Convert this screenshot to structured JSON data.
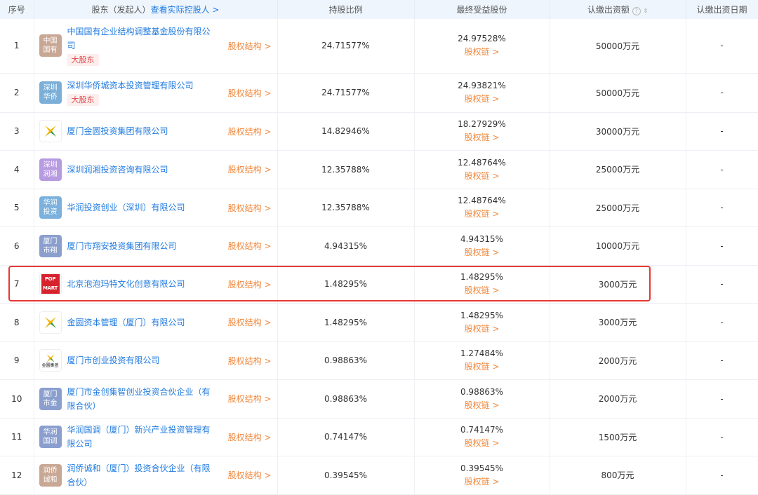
{
  "header": {
    "index": "序号",
    "shareholder": "股东（发起人）",
    "controller_link": "查看实际控股人 >",
    "ratio": "持股比例",
    "benefit": "最终受益股份",
    "amount": "认缴出资额",
    "date": "认缴出资日期"
  },
  "labels": {
    "struct": "股权结构 >",
    "chain": "股权链 >",
    "major": "大股东"
  },
  "rows": [
    {
      "no": "1",
      "logo": "中国国有",
      "logo_color": "#c9a795",
      "name": "中国国有企业结构调整基金股份有限公司",
      "major": true,
      "ratio": "24.71577%",
      "benefit": "24.97528%",
      "amount": "50000万元",
      "date": "-"
    },
    {
      "no": "2",
      "logo": "深圳华侨",
      "logo_color": "#7bafd8",
      "name": "深圳华侨城资本投资管理有限公司",
      "major": true,
      "ratio": "24.71577%",
      "benefit": "24.93821%",
      "amount": "50000万元",
      "date": "-"
    },
    {
      "no": "3",
      "logo": "",
      "logo_color": "",
      "name": "厦门金圆投资集团有限公司",
      "ratio": "14.82946%",
      "benefit": "18.27929%",
      "amount": "30000万元",
      "date": "-"
    },
    {
      "no": "4",
      "logo": "深圳润湘",
      "logo_color": "#b79be0",
      "name": "深圳润湘投资咨询有限公司",
      "ratio": "12.35788%",
      "benefit": "12.48764%",
      "amount": "25000万元",
      "date": "-"
    },
    {
      "no": "5",
      "logo": "华润投资",
      "logo_color": "#7bb1dc",
      "name": "华润投资创业（深圳）有限公司",
      "ratio": "12.35788%",
      "benefit": "12.48764%",
      "amount": "25000万元",
      "date": "-"
    },
    {
      "no": "6",
      "logo": "厦门市翔",
      "logo_color": "#8b9fce",
      "name": "厦门市翔安投资集团有限公司",
      "ratio": "4.94315%",
      "benefit": "4.94315%",
      "amount": "10000万元",
      "date": "-"
    },
    {
      "no": "7",
      "logo": "POP MART",
      "logo_color": "#d7222d",
      "name": "北京泡泡玛特文化创意有限公司",
      "ratio": "1.48295%",
      "benefit": "1.48295%",
      "amount": "3000万元",
      "date": "-"
    },
    {
      "no": "8",
      "logo": "",
      "logo_color": "",
      "name": "金圆资本管理（厦门）有限公司",
      "ratio": "1.48295%",
      "benefit": "1.48295%",
      "amount": "3000万元",
      "date": "-"
    },
    {
      "no": "9",
      "logo": "金圆集团",
      "logo_color": "",
      "name": "厦门市创业投资有限公司",
      "ratio": "0.98863%",
      "benefit": "1.27484%",
      "amount": "2000万元",
      "date": "-"
    },
    {
      "no": "10",
      "logo": "厦门市金",
      "logo_color": "#8b9fce",
      "name": "厦门市金创集智创业投资合伙企业（有限合伙）",
      "ratio": "0.98863%",
      "benefit": "0.98863%",
      "amount": "2000万元",
      "date": "-"
    },
    {
      "no": "11",
      "logo": "华润国调",
      "logo_color": "#8b9fce",
      "name": "华润国调（厦门）新兴产业投资管理有限公司",
      "ratio": "0.74147%",
      "benefit": "0.74147%",
      "amount": "1500万元",
      "date": "-"
    },
    {
      "no": "12",
      "logo": "润侨诚和",
      "logo_color": "#c9a795",
      "name": "润侨诚和（厦门）投资合伙企业（有限合伙）",
      "ratio": "0.39545%",
      "benefit": "0.39545%",
      "amount": "800万元",
      "date": "-"
    }
  ]
}
